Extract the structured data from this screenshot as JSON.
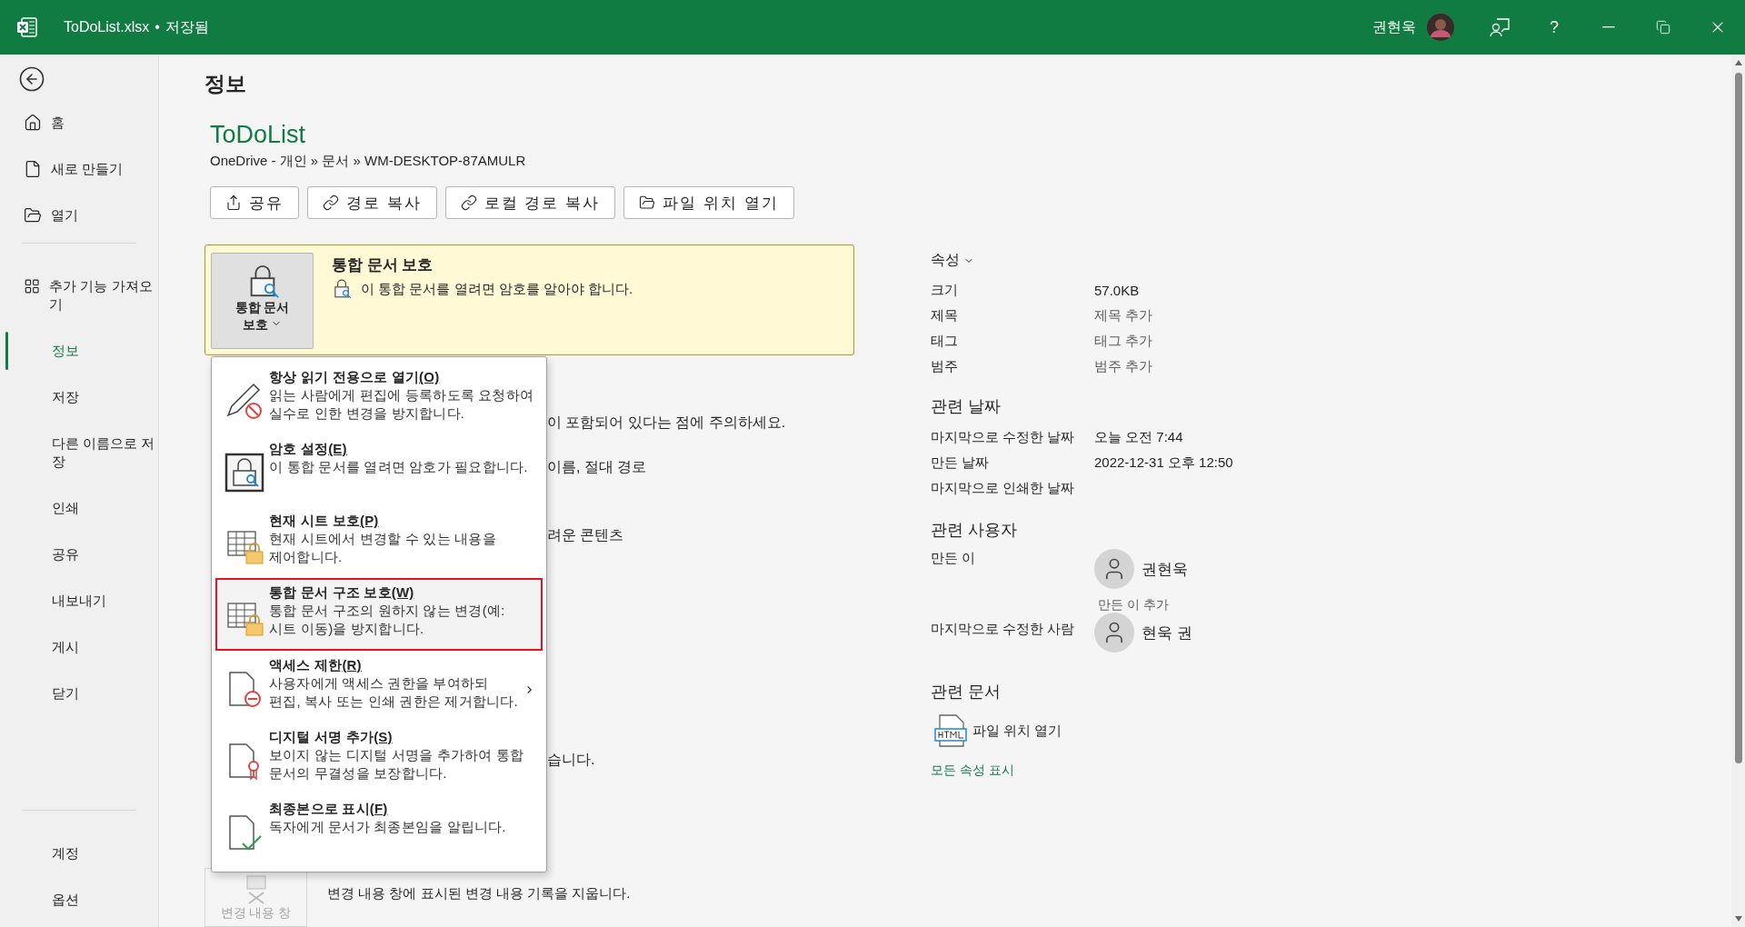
{
  "title_bar": {
    "file_name": "ToDoList.xlsx",
    "separator": "•",
    "save_status": "저장됨",
    "user_name": "권현욱",
    "help": "?"
  },
  "sidebar": {
    "items": [
      {
        "label": "홈",
        "kind": "home",
        "selected": false
      },
      {
        "label": "새로 만들기",
        "kind": "new",
        "selected": false
      },
      {
        "label": "열기",
        "kind": "open",
        "selected": false
      },
      {
        "label": "추가 기능 가져오기",
        "kind": "addins",
        "selected": false
      },
      {
        "label": "정보",
        "kind": "text",
        "selected": true
      },
      {
        "label": "저장",
        "kind": "text",
        "selected": false
      },
      {
        "label": "다른 이름으로 저장",
        "kind": "text",
        "selected": false
      },
      {
        "label": "인쇄",
        "kind": "text",
        "selected": false
      },
      {
        "label": "공유",
        "kind": "text",
        "selected": false
      },
      {
        "label": "내보내기",
        "kind": "text",
        "selected": false
      },
      {
        "label": "게시",
        "kind": "text",
        "selected": false
      },
      {
        "label": "닫기",
        "kind": "text",
        "selected": false
      }
    ],
    "bottom_items": [
      {
        "label": "계정",
        "selected": false
      },
      {
        "label": "옵션",
        "selected": false
      }
    ]
  },
  "page_title": "정보",
  "document": {
    "name": "ToDoList",
    "path": "OneDrive - 개인 » 문서 » WM-DESKTOP-87AMULR"
  },
  "actions": [
    {
      "label": "공유",
      "kind": "share"
    },
    {
      "label": "경로 복사",
      "kind": "link"
    },
    {
      "label": "로컬 경로 복사",
      "kind": "link"
    },
    {
      "label": "파일 위치 열기",
      "kind": "folder"
    }
  ],
  "protection": {
    "button_label": "통합 문서 보호",
    "title": "통합 문서 보호",
    "message": "이 통합 문서를 열려면 암호를 알아야 합니다.",
    "menu_open": true
  },
  "protect_menu": [
    {
      "kind": "read-only",
      "title": "항상 읽기 전용으로 열기",
      "access_key": "(O)",
      "description": "읽는 사람에게 편집에 등록하도록 요청하여 실수로 인한 변경을 방지합니다.",
      "highlighted": false,
      "submenu": false
    },
    {
      "kind": "password",
      "title": "암호 설정",
      "access_key": "(E)",
      "description": "이 통합 문서를 열려면 암호가 필요합니다.",
      "highlighted": false,
      "submenu": false
    },
    {
      "kind": "sheet",
      "title": "현재 시트 보호",
      "access_key": "(P)",
      "description": "현재 시트에서 변경할 수 있는 내용을 제어합니다.",
      "highlighted": false,
      "submenu": false
    },
    {
      "kind": "sheet",
      "title": "통합 문서 구조 보호",
      "access_key": "(W)",
      "description": "통합 문서 구조의 원하지 않는 변경(예: 시트 이동)을 방지합니다.",
      "highlighted": true,
      "submenu": false
    },
    {
      "kind": "restrict",
      "title": "액세스 제한",
      "access_key": "(R)",
      "description": "사용자에게 액세스 권한을 부여하되 편집, 복사 또는 인쇄 권한은 제거합니다.",
      "highlighted": false,
      "submenu": true
    },
    {
      "kind": "signature",
      "title": "디지털 서명 추가",
      "access_key": "(S)",
      "description": "보이지 않는 디지털 서명을 추가하여 통합 문서의 무결성을 보장합니다.",
      "highlighted": false,
      "submenu": false
    },
    {
      "kind": "final",
      "title": "최종본으로 표시",
      "access_key": "(F)",
      "description": "독자에게 문서가 최종본임을 알립니다.",
      "highlighted": false,
      "submenu": false
    }
  ],
  "covered_texts": [
    "이 포함되어 있다는 점에 주의하세요.",
    "이름, 절대 경로",
    "려운 콘텐츠",
    "습니다."
  ],
  "track_changes": {
    "button_label": "변경 내용 창",
    "description": "변경 내용 창에 표시된 변경 내용 기록을 지웁니다.",
    "disabled": true
  },
  "properties": {
    "heading": "속성",
    "rows": [
      {
        "label": "크기",
        "value": "57.0KB",
        "placeholder": false
      },
      {
        "label": "제목",
        "value": "제목 추가",
        "placeholder": true
      },
      {
        "label": "태그",
        "value": "태그 추가",
        "placeholder": true
      },
      {
        "label": "범주",
        "value": "범주 추가",
        "placeholder": true
      }
    ]
  },
  "related_dates": {
    "heading": "관련 날짜",
    "rows": [
      {
        "label": "마지막으로 수정한 날짜",
        "value": "오늘 오전 7:44"
      },
      {
        "label": "만든 날짜",
        "value": "2022-12-31 오후 12:50"
      },
      {
        "label": "마지막으로 인쇄한 날짜"
      }
    ]
  },
  "related_people": {
    "heading": "관련 사용자",
    "groups": [
      {
        "role": "만든 이",
        "people": [
          "권현욱"
        ],
        "add_label": "만든 이 추가"
      },
      {
        "role": "마지막으로 수정한 사람",
        "people": [
          "현욱 권"
        ]
      }
    ]
  },
  "related_documents": {
    "heading": "관련 문서",
    "items": [
      {
        "label": "파일 위치 열기",
        "kind": "html"
      }
    ]
  },
  "show_all_link": "모든 속성 표시"
}
